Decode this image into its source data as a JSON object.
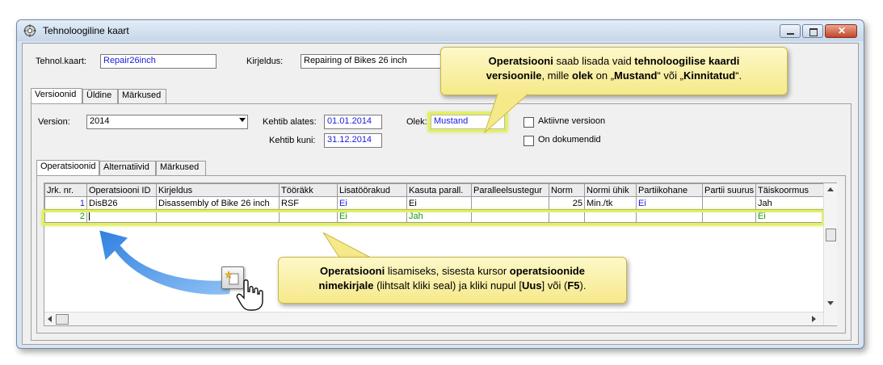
{
  "window": {
    "title": "Tehnoloogiline kaart"
  },
  "header": {
    "tehnol_label": "Tehnol.kaart:",
    "tehnol_value": "Repair26inch",
    "kirjeldus_label": "Kirjeldus:",
    "kirjeldus_value": "Repairing of Bikes 26 inch"
  },
  "tabs_top": [
    "Versioonid",
    "Üldine",
    "Märkused"
  ],
  "version": {
    "label": "Version:",
    "value": "2014",
    "kehtib_alates_label": "Kehtib alates:",
    "kehtib_alates_value": "01.01.2014",
    "kehtib_kuni_label": "Kehtib kuni:",
    "kehtib_kuni_value": "31.12.2014",
    "olek_label": "Olek:",
    "olek_value": "Mustand",
    "aktiivne_label": "Aktiivne versioon",
    "dokumendid_label": "On dokumendid"
  },
  "tabs_inner": [
    "Operatsioonid",
    "Alternatiivid",
    "Märkused"
  ],
  "grid": {
    "columns": [
      "Jrk. nr.",
      "Operatsiooni ID",
      "Kirjeldus",
      "Tööräkk",
      "Lisatöörakud",
      "Kasuta parall.",
      "Paralleelsustegur",
      "Norm",
      "Normi ühik",
      "Partiikohane",
      "Partii suurus",
      "Täiskoormus"
    ],
    "rows": [
      [
        "1",
        "DisB26",
        "Disassembly of Bike 26 inch",
        "RSF",
        "Ei",
        "Ei",
        "",
        "25",
        "Min./tk",
        "Ei",
        "",
        "Jah"
      ],
      [
        "2",
        "",
        "",
        "",
        "Ei",
        "Jah",
        "",
        "",
        "",
        "",
        "",
        "Ei"
      ]
    ]
  },
  "callout_top": {
    "p1": "Operatsiooni",
    "p2": " saab lisada vaid ",
    "p3": "tehnoloogilise kaardi",
    "p4": "versioonile",
    "p5": ", mille ",
    "p6": "olek",
    "p7": " on „",
    "p8": "Mustand",
    "p9": "“ või „",
    "p10": "Kinnitatud",
    "p11": "“."
  },
  "callout_bottom": {
    "p1": "Operatsiooni",
    "p2": " lisamiseks, sisesta kursor ",
    "p3": "operatsioonide",
    "p4": "nimekirjale",
    "p5": " (lihtsalt kliki seal) ja kliki nupul [",
    "p6": "Uus",
    "p7": "] või (",
    "p8": "F5",
    "p9": ")."
  },
  "colors": {
    "highlight": "#e4f05a",
    "callout": "#f6e98a",
    "link_blue": "#1a1ae0",
    "green": "#129a12"
  },
  "icons": [
    "app-icon",
    "minimize-icon",
    "maximize-icon",
    "close-icon",
    "dropdown-arrow-icon",
    "new-record-icon",
    "hand-cursor-icon",
    "curved-arrow-icon"
  ]
}
